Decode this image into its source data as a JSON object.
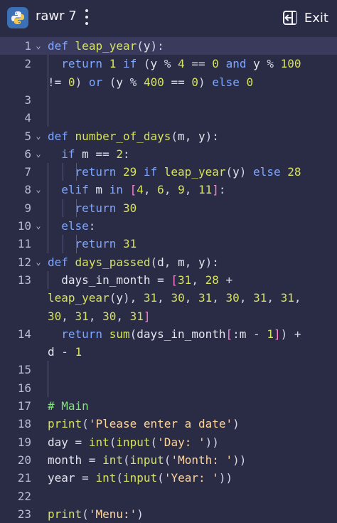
{
  "header": {
    "title": "rawr 7",
    "exit_label": "Exit"
  },
  "editor": {
    "lines": [
      {
        "n": "1",
        "text": "def leap_year(y):"
      },
      {
        "n": "2",
        "text": "  return 1 if (y % 4 == 0 and y % 100"
      },
      {
        "n": "",
        "text": "!= 0) or (y % 400 == 0) else 0"
      },
      {
        "n": "3",
        "text": ""
      },
      {
        "n": "4",
        "text": ""
      },
      {
        "n": "5",
        "text": "def number_of_days(m, y):"
      },
      {
        "n": "6",
        "text": "  if m == 2:"
      },
      {
        "n": "7",
        "text": "    return 29 if leap_year(y) else 28"
      },
      {
        "n": "8",
        "text": "  elif m in [4, 6, 9, 11]:"
      },
      {
        "n": "9",
        "text": "    return 30"
      },
      {
        "n": "10",
        "text": "  else:"
      },
      {
        "n": "11",
        "text": "    return 31"
      },
      {
        "n": "12",
        "text": "def days_passed(d, m, y):"
      },
      {
        "n": "13",
        "text": "  days_in_month = [31, 28 +"
      },
      {
        "n": "",
        "text": "leap_year(y), 31, 30, 31, 30, 31, 31,"
      },
      {
        "n": "",
        "text": "30, 31, 30, 31]"
      },
      {
        "n": "14",
        "text": "  return sum(days_in_month[:m - 1]) +"
      },
      {
        "n": "",
        "text": "d - 1"
      },
      {
        "n": "15",
        "text": ""
      },
      {
        "n": "16",
        "text": ""
      },
      {
        "n": "17",
        "text": "# Main"
      },
      {
        "n": "18",
        "text": "print('Please enter a date')"
      },
      {
        "n": "19",
        "text": "day = int(input('Day: '))"
      },
      {
        "n": "20",
        "text": "month = int(input('Month: '))"
      },
      {
        "n": "21",
        "text": "year = int(input('Year: '))"
      },
      {
        "n": "22",
        "text": ""
      },
      {
        "n": "23",
        "text": "print('Menu:')"
      }
    ]
  }
}
